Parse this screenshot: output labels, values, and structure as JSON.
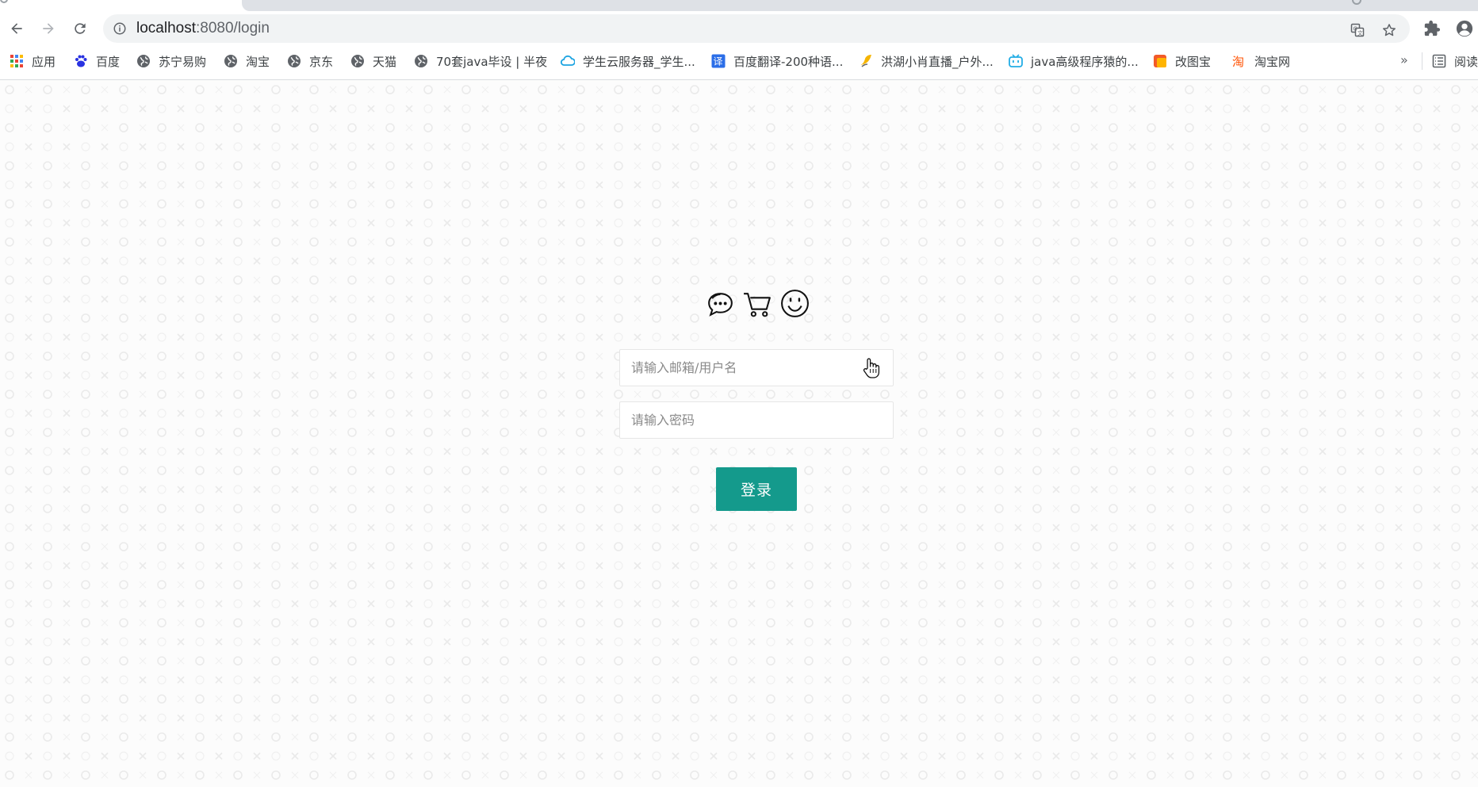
{
  "browser": {
    "url_host": "localhost",
    "url_path": ":8080/login",
    "bookmarks": [
      {
        "label": "应用",
        "icon": "apps-grid-icon"
      },
      {
        "label": "百度",
        "icon": "baidu-paw-icon"
      },
      {
        "label": "苏宁易购",
        "icon": "globe-icon"
      },
      {
        "label": "淘宝",
        "icon": "globe-icon"
      },
      {
        "label": "京东",
        "icon": "globe-icon"
      },
      {
        "label": "天猫",
        "icon": "globe-icon"
      },
      {
        "label": "70套java毕设 | 半夜",
        "icon": "globe-icon"
      },
      {
        "label": "学生云服务器_学生...",
        "icon": "cloud-icon"
      },
      {
        "label": "百度翻译-200种语...",
        "icon": "translate-icon"
      },
      {
        "label": "洪湖小肖直播_户外...",
        "icon": "fish-icon"
      },
      {
        "label": "java高级程序猿的...",
        "icon": "bilibili-icon"
      },
      {
        "label": "改图宝",
        "icon": "gaitubao-icon"
      },
      {
        "label": "淘宝网",
        "icon": "taobao-icon"
      }
    ],
    "more_label": "»",
    "reading_list_label": "阅读"
  },
  "login": {
    "username_placeholder": "请输入邮箱/用户名",
    "password_placeholder": "请输入密码",
    "submit_label": "登录"
  },
  "colors": {
    "accent": "#149a8c",
    "page_bg": "#fcfcfc",
    "pattern": "#ececec"
  }
}
